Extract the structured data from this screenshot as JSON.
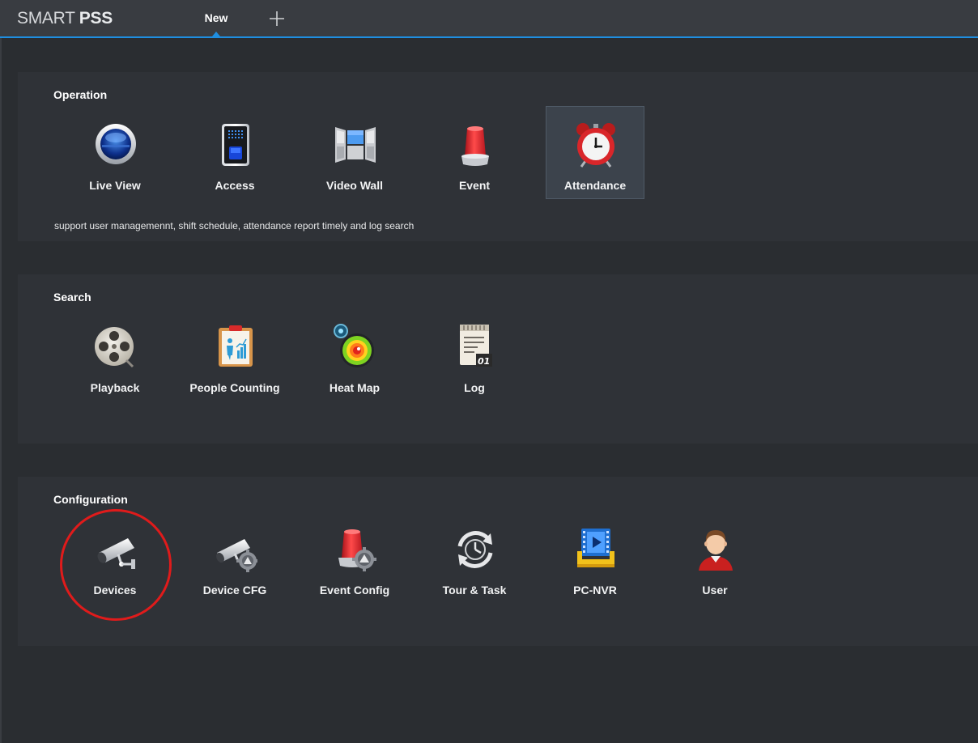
{
  "app": {
    "logo_light": "SMART ",
    "logo_bold": "PSS"
  },
  "tabs": [
    {
      "label": "New",
      "active": true
    }
  ],
  "add_tab_icon": "plus-icon",
  "sections": [
    {
      "title": "Operation",
      "items": [
        {
          "label": "Live View",
          "icon": "live-view-icon"
        },
        {
          "label": "Access",
          "icon": "access-icon"
        },
        {
          "label": "Video Wall",
          "icon": "video-wall-icon"
        },
        {
          "label": "Event",
          "icon": "event-alarm-icon"
        },
        {
          "label": "Attendance",
          "icon": "alarm-clock-icon",
          "selected": true
        }
      ],
      "description": "support user managemennt, shift schedule, attendance report timely and log search"
    },
    {
      "title": "Search",
      "items": [
        {
          "label": "Playback",
          "icon": "film-reel-icon"
        },
        {
          "label": "People Counting",
          "icon": "people-counting-icon"
        },
        {
          "label": "Heat Map",
          "icon": "heat-map-icon"
        },
        {
          "label": "Log",
          "icon": "log-icon"
        }
      ]
    },
    {
      "title": "Configuration",
      "items": [
        {
          "label": "Devices",
          "icon": "camera-icon",
          "highlighted": true
        },
        {
          "label": "Device CFG",
          "icon": "camera-gear-icon"
        },
        {
          "label": "Event Config",
          "icon": "alarm-gear-icon"
        },
        {
          "label": "Tour & Task",
          "icon": "tour-task-icon"
        },
        {
          "label": "PC-NVR",
          "icon": "pc-nvr-icon"
        },
        {
          "label": "User",
          "icon": "user-icon"
        }
      ]
    }
  ],
  "colors": {
    "accent": "#1f8ee0",
    "highlight_ring": "#e01b1b",
    "background": "#2a2d31",
    "panel": "#2f3237"
  }
}
